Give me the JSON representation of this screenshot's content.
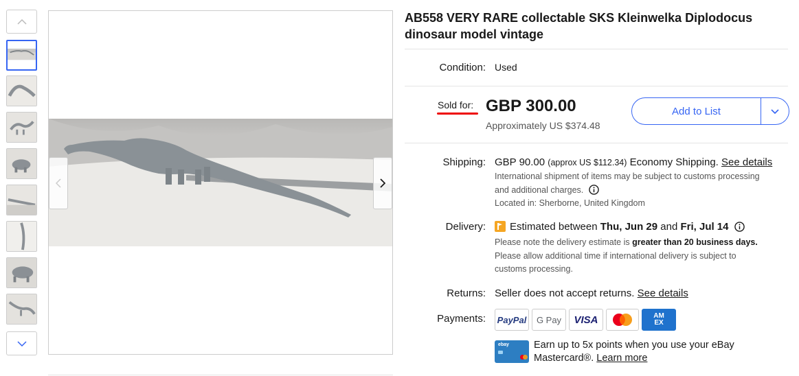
{
  "listing": {
    "title": "AB558 VERY RARE collectable SKS Kleinwelka Diplodocus dinosaur model vintage"
  },
  "gallery": {
    "thumbnail_count": 8,
    "active_index": 0
  },
  "condition": {
    "label": "Condition:",
    "value": "Used"
  },
  "price": {
    "sold_label": "Sold for:",
    "amount": "GBP 300.00",
    "approx": "Approximately US $374.48"
  },
  "actions": {
    "add_to_list": "Add to List"
  },
  "shipping": {
    "label": "Shipping:",
    "cost": "GBP 90.00",
    "cost_approx": "(approx US $112.34)",
    "method": "Economy Shipping.",
    "details_link": "See details",
    "note_line1": "International shipment of items may be subject to customs processing",
    "note_line2": "and additional charges.",
    "location": "Located in: Sherborne, United Kingdom"
  },
  "delivery": {
    "label": "Delivery:",
    "prefix": "Estimated between",
    "start": "Thu, Jun 29",
    "and": "and",
    "end": "Fri, Jul 14",
    "note_prefix": "Please note the delivery estimate is",
    "note_bold": "greater than 20 business days.",
    "note_line2": "Please allow additional time if international delivery is subject to",
    "note_line3": "customs processing."
  },
  "returns": {
    "label": "Returns:",
    "text": "Seller does not accept returns.",
    "details_link": "See details"
  },
  "payments": {
    "label": "Payments:",
    "methods": [
      "PayPal",
      "Google Pay",
      "VISA",
      "Mastercard",
      "American Express"
    ],
    "paypal_text": "PayPal",
    "gpay_text": "G Pay",
    "visa_text": "VISA",
    "amex_text": "AM EX"
  },
  "promo": {
    "card_text": "ebay",
    "line1": "Earn up to 5x points when you use your eBay",
    "line2": "Mastercard®.",
    "link": "Learn more"
  },
  "colors": {
    "accent": "#3665f3",
    "sold_underline": "#e00000",
    "delivery_flag": "#f5a623"
  }
}
